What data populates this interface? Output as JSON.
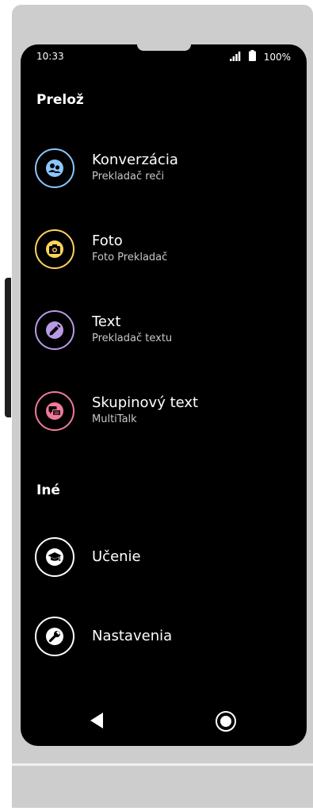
{
  "status_bar": {
    "time": "10:33",
    "battery_percent": "100%",
    "signal_icon": "signal-bars-icon",
    "battery_icon": "battery-icon"
  },
  "sections": {
    "translate": {
      "title": "Prelož",
      "items": [
        {
          "title": "Konverzácia",
          "subtitle": "Prekladač reči",
          "icon": "people-icon",
          "color": "#8cc6ff"
        },
        {
          "title": "Foto",
          "subtitle": "Foto Prekladač",
          "icon": "camera-icon",
          "color": "#ffd35c"
        },
        {
          "title": "Text",
          "subtitle": "Prekladač textu",
          "icon": "pen-icon",
          "color": "#b89ae6"
        },
        {
          "title": "Skupinový text",
          "subtitle": "MultiTalk",
          "icon": "chat-bubbles-icon",
          "color": "#f07a9a"
        }
      ]
    },
    "other": {
      "title": "Iné",
      "items": [
        {
          "title": "Učenie",
          "icon": "graduation-cap-icon",
          "color": "#ffffff"
        },
        {
          "title": "Nastavenia",
          "icon": "wrench-icon",
          "color": "#ffffff"
        }
      ]
    }
  },
  "nav": {
    "back_icon": "back-triangle-icon",
    "home_icon": "home-circle-icon"
  }
}
